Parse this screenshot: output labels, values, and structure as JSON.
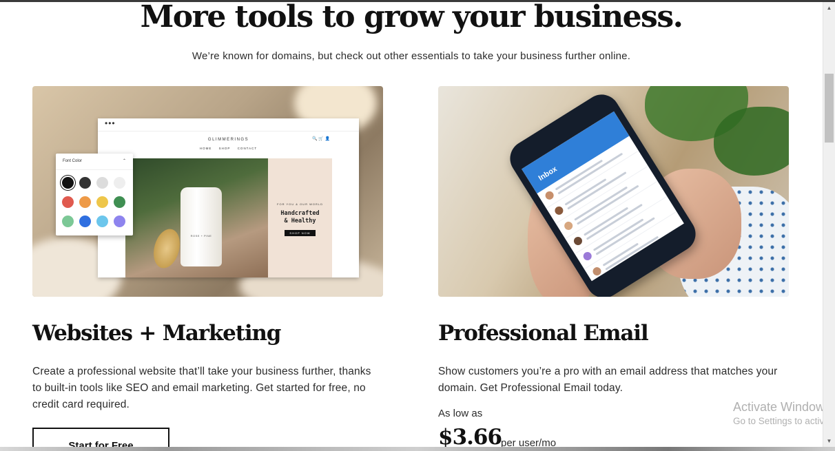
{
  "section": {
    "headline": "More tools to grow your business.",
    "subheadline": "We’re known for domains, but check out other essentials to take your business further online."
  },
  "websites_card": {
    "title": "Websites + Marketing",
    "description": "Create a professional website that’ll take your business further, thanks to built-in tools like SEO and email marketing. Get started for free, no credit card required.",
    "cta_label": "Start for Free",
    "mockup": {
      "browser_dots": "•••",
      "site_name": "GLIMMERINGS",
      "nav": [
        "HOME",
        "SHOP",
        "CONTACT"
      ],
      "header_icons": "🔍 🛒 👤",
      "picker_title": "Font Color",
      "picker_caret": "⌃",
      "hero_small": "FOR YOU & OUR WORLD",
      "hero_title_line1": "Handcrafted",
      "hero_title_line2": "& Healthy",
      "hero_button": "SHOP NOW",
      "jar_label": "ROSE + PINE",
      "swatches": [
        "#111111",
        "#333333",
        "#dcdcdc",
        "#eeeeee",
        "#e05a4f",
        "#ee9a47",
        "#eec64a",
        "#3f8f52",
        "#7cc896",
        "#2f6fe0",
        "#6cc6ec",
        "#8e84ee"
      ]
    }
  },
  "email_card": {
    "title": "Professional Email",
    "description": "Show customers you’re a pro with an email address that matches your domain. Get Professional Email today.",
    "price_prefix": "As low as",
    "price": "$3.66",
    "price_unit": "per user/mo",
    "mockup": {
      "inbox_label": "Inbox"
    }
  },
  "windows_watermark": {
    "line1": "Activate Windows",
    "line2": "Go to Settings to activate Windows."
  },
  "scrollbar": {
    "up_arrow": "▲",
    "down_arrow": "▼"
  }
}
